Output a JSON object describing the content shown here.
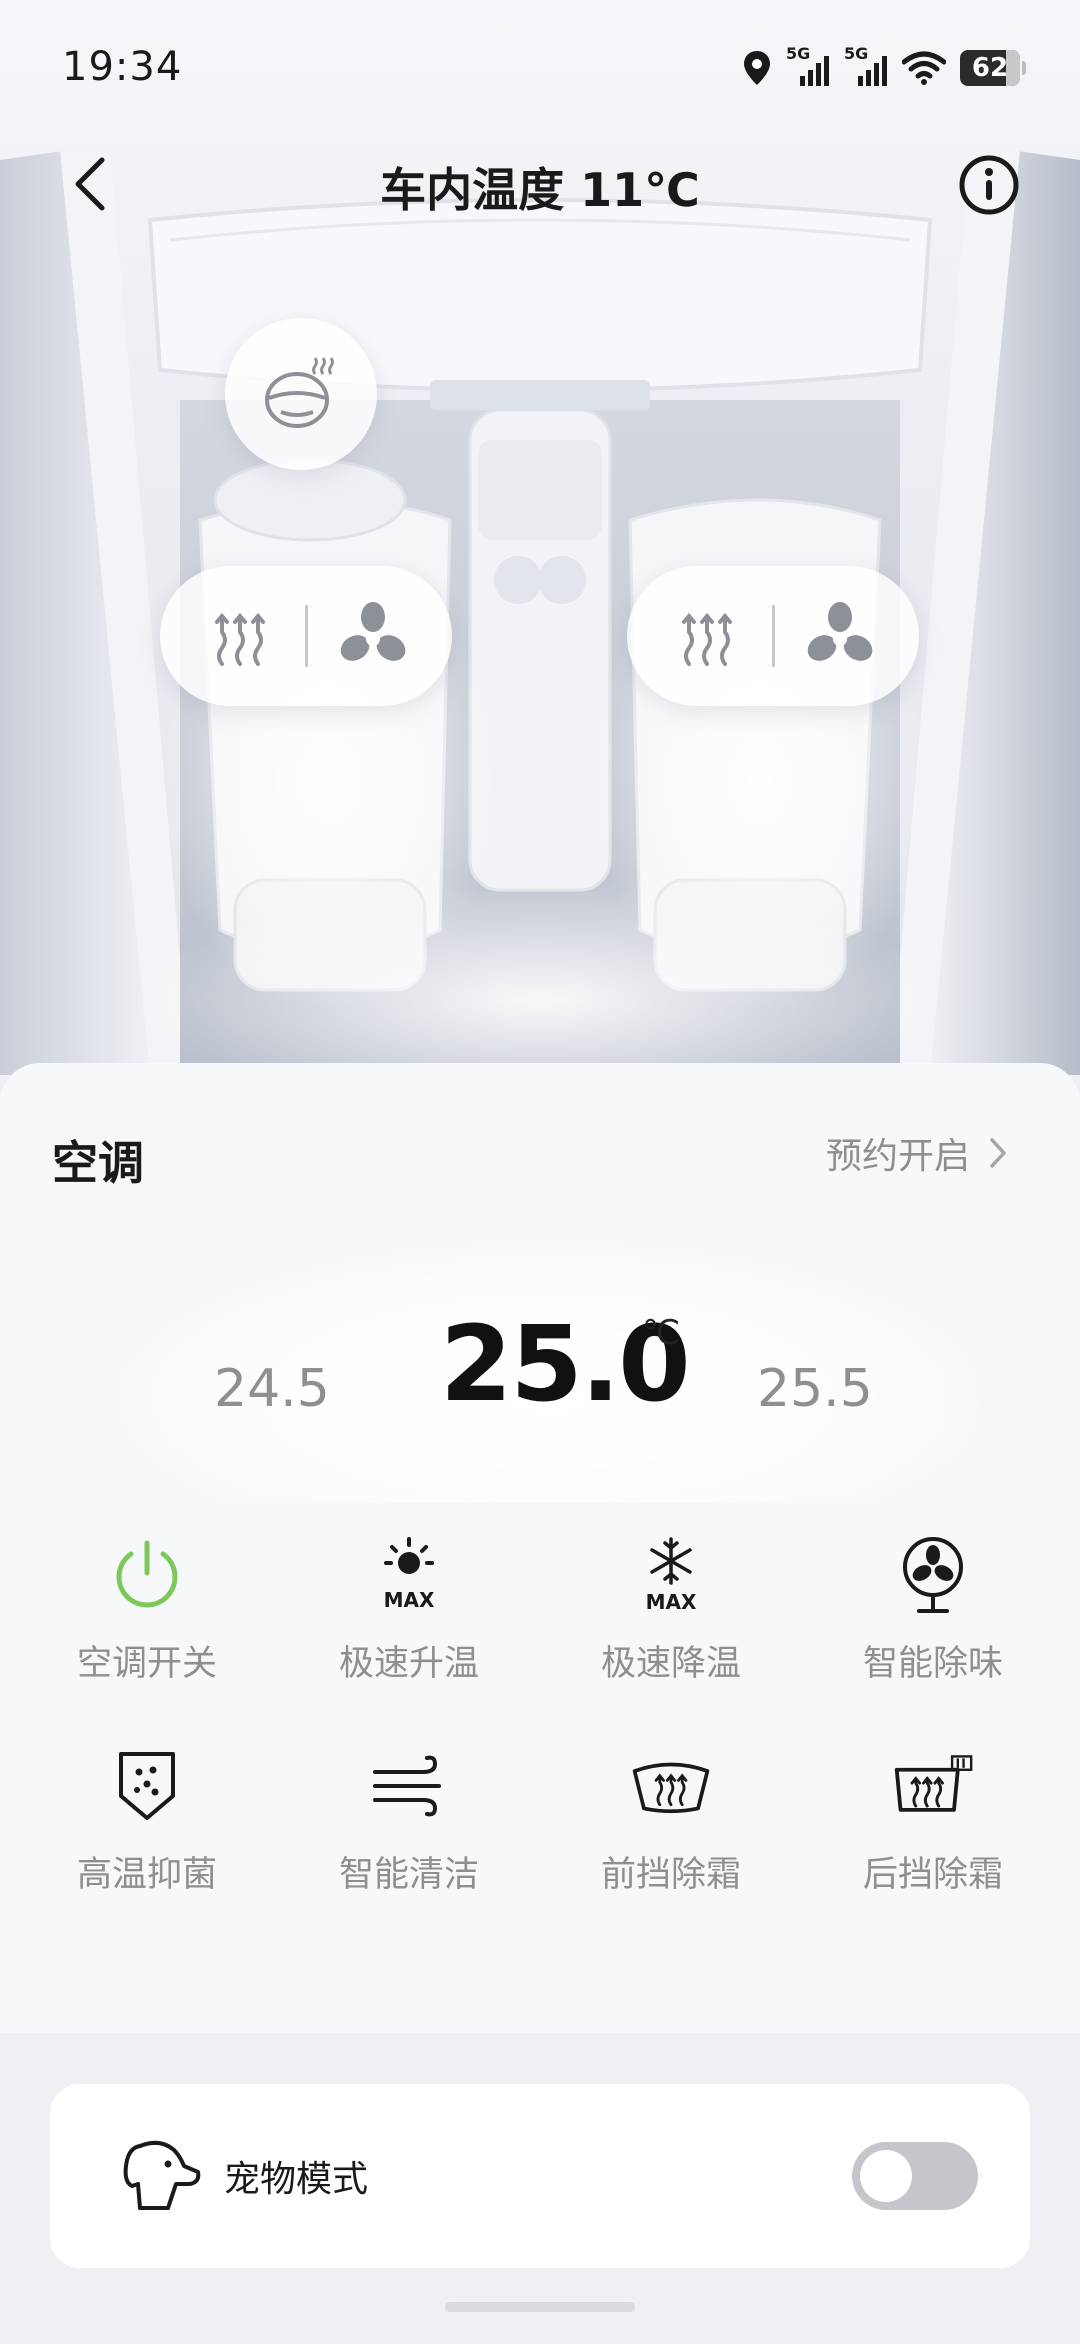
{
  "status_bar": {
    "time": "19:34",
    "signal_1_label": "5G",
    "signal_2_label": "5G",
    "battery": "62",
    "icons": [
      "location-icon",
      "signal-5g-icon",
      "signal-5g-icon",
      "wifi-icon",
      "battery-icon"
    ]
  },
  "header": {
    "title": "车内温度 11℃",
    "back_icon": "chevron-left-icon",
    "info_icon": "info-icon"
  },
  "car_controls": {
    "steering_heat_icon": "heated-steering-wheel-icon",
    "left_seat": {
      "heat_icon": "seat-heat-icon",
      "vent_icon": "seat-ventilation-icon"
    },
    "right_seat": {
      "heat_icon": "seat-heat-icon",
      "vent_icon": "seat-ventilation-icon"
    }
  },
  "ac": {
    "title": "空调",
    "schedule_label": "预约开启",
    "temp_prev": "24.5",
    "temp_current": "25.0",
    "temp_unit": "℃",
    "temp_next": "25.5",
    "accent_color": "#7cc95a",
    "functions": [
      {
        "label": "空调开关",
        "icon": "power-icon"
      },
      {
        "label": "极速升温",
        "icon": "sun-max-icon"
      },
      {
        "label": "极速降温",
        "icon": "snowflake-max-icon"
      },
      {
        "label": "智能除味",
        "icon": "fan-icon"
      },
      {
        "label": "高温抑菌",
        "icon": "shield-germ-icon"
      },
      {
        "label": "智能清洁",
        "icon": "wind-icon"
      },
      {
        "label": "前挡除霜",
        "icon": "front-defrost-icon"
      },
      {
        "label": "后挡除霜",
        "icon": "rear-defrost-icon"
      }
    ]
  },
  "pet_mode": {
    "label": "宠物模式",
    "icon": "dog-icon",
    "enabled": false
  }
}
